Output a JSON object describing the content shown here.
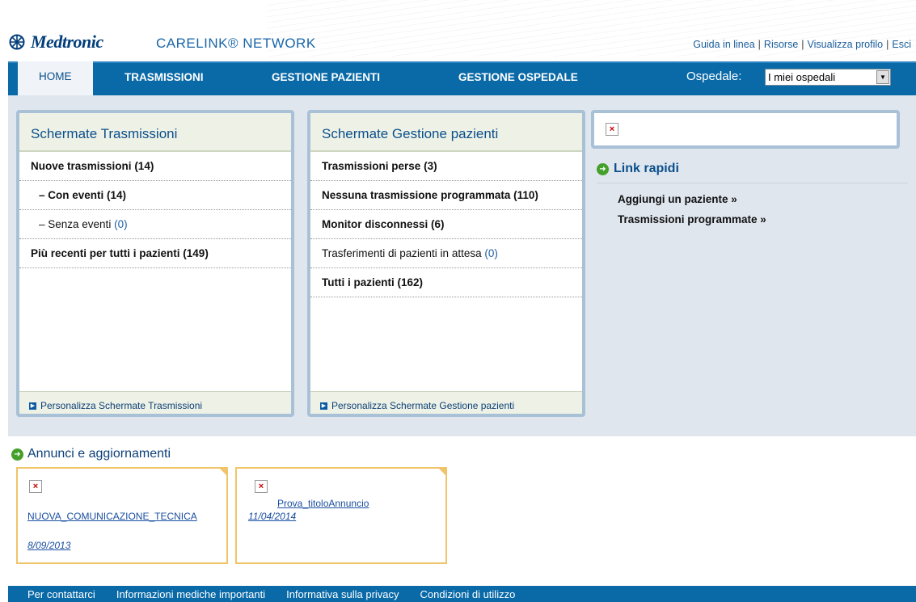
{
  "brand": {
    "logo_text": "Medtronic",
    "product_name": "CARELINK® NETWORK",
    "brand_color": "#003d7a"
  },
  "top_links": [
    {
      "label": "Guida in linea"
    },
    {
      "label": "Risorse"
    },
    {
      "label": "Visualizza profilo"
    },
    {
      "label": "Esci"
    }
  ],
  "top_link_sep": "|",
  "nav": {
    "items": [
      {
        "label": "HOME",
        "active": true
      },
      {
        "label": "TRASMISSIONI"
      },
      {
        "label": "GESTIONE PAZIENTI"
      },
      {
        "label": "GESTIONE OSPEDALE"
      }
    ],
    "hospital_label": "Ospedale:",
    "hospital_selected": "I miei ospedali",
    "color": "#0a6aa8"
  },
  "panel_transmissions": {
    "title": "Schermate Trasmissioni",
    "rows": [
      {
        "label": "Nuove trasmissioni",
        "count": "(14)"
      },
      {
        "label": "– Con eventi",
        "count": "(14)"
      },
      {
        "label": "– Senza eventi",
        "count": "(0)"
      },
      {
        "label": "Più recenti per tutti i pazienti",
        "count": "(149)"
      }
    ],
    "footer": "Personalizza Schermate Trasmissioni"
  },
  "panel_patients": {
    "title": "Schermate Gestione pazienti",
    "rows": [
      {
        "label": "Trasmissioni perse",
        "count": "(3)"
      },
      {
        "label": "Nessuna trasmissione programmata",
        "count": "(110)"
      },
      {
        "label": "Monitor disconnessi",
        "count": "(6)"
      },
      {
        "label": "Trasferimenti di pazienti in attesa",
        "count": "(0)"
      },
      {
        "label": "Tutti i pazienti",
        "count": "(162)"
      }
    ],
    "footer": "Personalizza Schermate Gestione pazienti"
  },
  "quick_links": {
    "title": "Link rapidi",
    "items": [
      {
        "label": "Aggiungi un paziente »"
      },
      {
        "label": "Trasmissioni programmate »"
      }
    ]
  },
  "announcements": {
    "title": "Annunci e aggiornamenti",
    "items": [
      {
        "title": "NUOVA_COMUNICAZIONE_TECNICA",
        "date": "8/09/2013"
      },
      {
        "title": "Prova_titoloAnnuncio",
        "date": "11/04/2014"
      }
    ],
    "accent": "#f0c46a"
  },
  "footer_links": [
    {
      "label": "Per contattarci"
    },
    {
      "label": "Informazioni mediche importanti"
    },
    {
      "label": "Informativa sulla privacy"
    },
    {
      "label": "Condizioni di utilizzo"
    }
  ]
}
